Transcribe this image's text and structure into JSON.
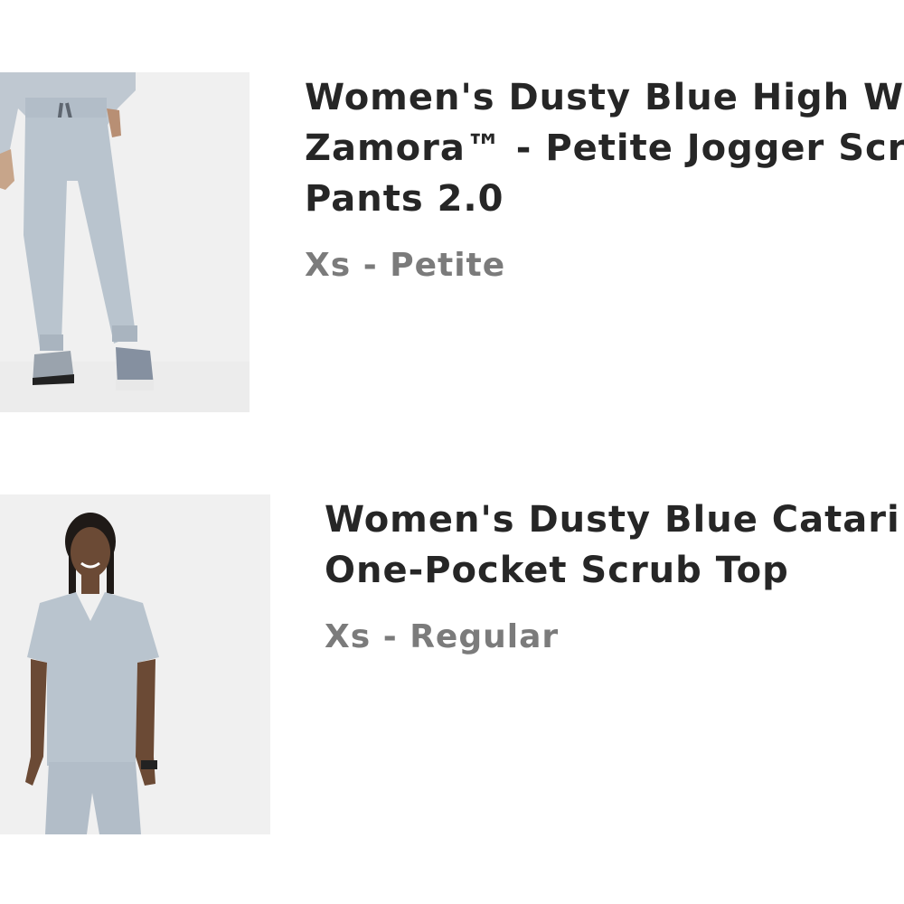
{
  "cart": {
    "items": [
      {
        "title_lines": [
          "Women's Dusty Blue High W",
          "Zamora™ - Petite Jogger Scr",
          "Pants 2.0"
        ],
        "variant": "Xs - Petite",
        "image_desc": "jogger-pants-photo"
      },
      {
        "title_lines": [
          "Women's Dusty Blue Catari",
          "One-Pocket Scrub Top"
        ],
        "variant": "Xs - Regular",
        "image_desc": "scrub-top-photo"
      }
    ]
  },
  "colors": {
    "title": "#262626",
    "variant": "#7b7b7b",
    "thumb_bg": "#f1f1f1",
    "scrub": "#b9c4ce"
  }
}
